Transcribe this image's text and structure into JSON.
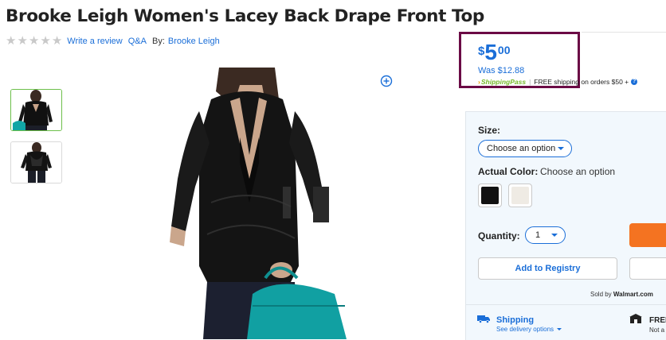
{
  "product": {
    "title": "Brooke Leigh Women's Lacey Back Drape Front Top"
  },
  "reviews": {
    "stars": [
      "★",
      "★",
      "★",
      "★",
      "★"
    ],
    "write_review": "Write a review",
    "qa": "Q&A",
    "by_label": "By:",
    "brand": "Brooke Leigh"
  },
  "price": {
    "currency": "$",
    "dollars": "5",
    "cents": "00",
    "was": "Was $12.88"
  },
  "shipping_pass": {
    "caret": "›",
    "logo_text": "ShippingPass",
    "pipe": "|",
    "free_text": "FREE shipping on orders $50 +",
    "help": "?"
  },
  "options": {
    "size_label": "Size:",
    "size_value": "Choose an option",
    "color_label": "Actual Color:",
    "color_value": "Choose an option",
    "swatches": [
      {
        "name": "black",
        "color": "#111111"
      },
      {
        "name": "ivory",
        "color": "#efebe4"
      }
    ],
    "quantity_label": "Quantity:",
    "quantity_value": "1"
  },
  "actions": {
    "add_to_registry": "Add to Registry",
    "add_to_cart_color": "#f47321"
  },
  "seller": {
    "prefix": "Sold by",
    "name": "Walmart.com"
  },
  "delivery": {
    "shipping_title": "Shipping",
    "shipping_link": "See delivery options",
    "pickup_title": "FREE",
    "pickup_sub": "Not a"
  },
  "colors": {
    "link_blue": "#1a6ed8",
    "price_box_border": "#6b0b45",
    "shipping_pass_green": "#76b82a"
  }
}
